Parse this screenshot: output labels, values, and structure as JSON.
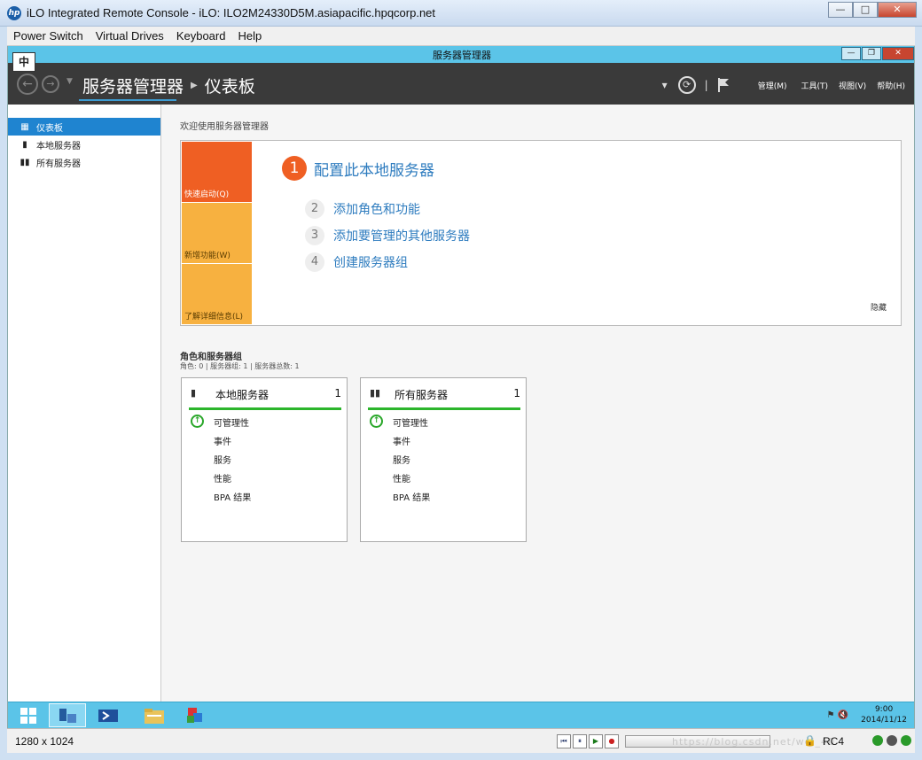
{
  "ilo": {
    "title": "iLO Integrated Remote Console - iLO: ILO2M24330D5M.asiapacific.hpqcorp.net",
    "logo": "hp",
    "menu": [
      "Power Switch",
      "Virtual Drives",
      "Keyboard",
      "Help"
    ],
    "resolution": "1280 x 1024",
    "encryption": "RC4",
    "watermark": "https://blog.csdn.net/wei_40"
  },
  "ime": "中",
  "server_manager": {
    "window_title": "服务器管理器",
    "breadcrumb_root": "服务器管理器",
    "breadcrumb_current": "仪表板",
    "menus": [
      "管理(M)",
      "工具(T)",
      "视图(V)",
      "帮助(H)"
    ]
  },
  "sidebar": {
    "items": [
      {
        "label": "仪表板",
        "icon": "dashboard-icon",
        "active": true
      },
      {
        "label": "本地服务器",
        "icon": "server-icon",
        "active": false
      },
      {
        "label": "所有服务器",
        "icon": "servers-icon",
        "active": false
      }
    ]
  },
  "welcome": {
    "title": "欢迎使用服务器管理器",
    "tiles": [
      "快速启动(Q)",
      "新增功能(W)",
      "了解详细信息(L)"
    ],
    "steps": [
      {
        "num": "1",
        "text": "配置此本地服务器"
      },
      {
        "num": "2",
        "text": "添加角色和功能"
      },
      {
        "num": "3",
        "text": "添加要管理的其他服务器"
      },
      {
        "num": "4",
        "text": "创建服务器组"
      }
    ],
    "hide": "隐藏"
  },
  "roles": {
    "title": "角色和服务器组",
    "subtitle": "角色: 0 | 服务器组: 1 | 服务器总数: 1",
    "cards": [
      {
        "title": "本地服务器",
        "count": "1",
        "rows": [
          "可管理性",
          "事件",
          "服务",
          "性能",
          "BPA 结果"
        ]
      },
      {
        "title": "所有服务器",
        "count": "1",
        "rows": [
          "可管理性",
          "事件",
          "服务",
          "性能",
          "BPA 结果"
        ]
      }
    ]
  },
  "taskbar": {
    "time": "9:00",
    "date": "2014/11/12"
  },
  "colors": {
    "accent": "#1f84d0",
    "quick_start": "#ef5f23",
    "tile_yellow": "#f7b140",
    "status_ok": "#2cb52c",
    "taskbar": "#5bc4e8"
  }
}
